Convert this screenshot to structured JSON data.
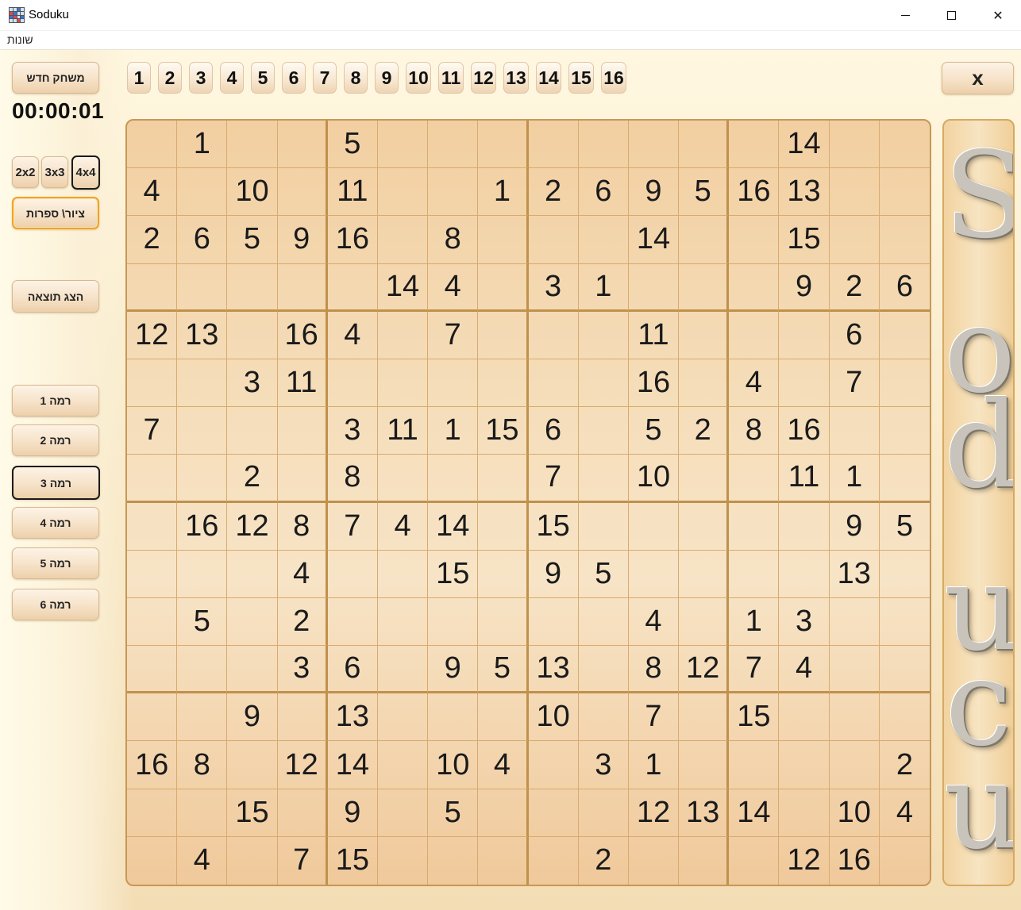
{
  "window": {
    "title": "Soduku"
  },
  "menu": {
    "misc": "שונות"
  },
  "controls": {
    "new_game": "משחק חדש",
    "timer": "00:00:01",
    "size_2x2": "2x2",
    "size_3x3": "3x3",
    "size_4x4": "4x4",
    "draw_digits": "ציור\\ ספרות",
    "show_result": "הצג תוצאה",
    "close": "x"
  },
  "levels": [
    "רמה 1",
    "רמה 2",
    "רמה 3",
    "רמה 4",
    "רמה 5",
    "רמה 6"
  ],
  "selected_level": 3,
  "selected_size": "4x4",
  "number_buttons": [
    "1",
    "2",
    "3",
    "4",
    "5",
    "6",
    "7",
    "8",
    "9",
    "10",
    "11",
    "12",
    "13",
    "14",
    "15",
    "16"
  ],
  "logo": {
    "letters": [
      "S",
      "o",
      "d",
      "u",
      "c",
      "u"
    ]
  },
  "board": [
    [
      "",
      "1",
      "",
      "",
      "5",
      "",
      "",
      "",
      "",
      "",
      "",
      "",
      "",
      "14",
      "",
      ""
    ],
    [
      "4",
      "",
      "10",
      "",
      "11",
      "",
      "",
      "1",
      "2",
      "6",
      "9",
      "5",
      "16",
      "13",
      "",
      ""
    ],
    [
      "2",
      "6",
      "5",
      "9",
      "16",
      "",
      "8",
      "",
      "",
      "",
      "14",
      "",
      "",
      "15",
      "",
      ""
    ],
    [
      "",
      "",
      "",
      "",
      "",
      "14",
      "4",
      "",
      "3",
      "1",
      "",
      "",
      "",
      "9",
      "2",
      "6"
    ],
    [
      "12",
      "13",
      "",
      "16",
      "4",
      "",
      "7",
      "",
      "",
      "",
      "11",
      "",
      "",
      "",
      "6",
      ""
    ],
    [
      "",
      "",
      "3",
      "11",
      "",
      "",
      "",
      "",
      "",
      "",
      "16",
      "",
      "4",
      "",
      "7",
      ""
    ],
    [
      "7",
      "",
      "",
      "",
      "3",
      "11",
      "1",
      "15",
      "6",
      "",
      "5",
      "2",
      "8",
      "16",
      "",
      ""
    ],
    [
      "",
      "",
      "2",
      "",
      "8",
      "",
      "",
      "",
      "7",
      "",
      "10",
      "",
      "",
      "11",
      "1",
      ""
    ],
    [
      "",
      "16",
      "12",
      "8",
      "7",
      "4",
      "14",
      "",
      "15",
      "",
      "",
      "",
      "",
      "",
      "9",
      "5"
    ],
    [
      "",
      "",
      "",
      "4",
      "",
      "",
      "15",
      "",
      "9",
      "5",
      "",
      "",
      "",
      "",
      "13",
      ""
    ],
    [
      "",
      "5",
      "",
      "2",
      "",
      "",
      "",
      "",
      "",
      "",
      "4",
      "",
      "1",
      "3",
      "",
      ""
    ],
    [
      "",
      "",
      "",
      "3",
      "6",
      "",
      "9",
      "5",
      "13",
      "",
      "8",
      "12",
      "7",
      "4",
      "",
      ""
    ],
    [
      "",
      "",
      "9",
      "",
      "13",
      "",
      "",
      "",
      "10",
      "",
      "7",
      "",
      "15",
      "",
      "",
      ""
    ],
    [
      "16",
      "8",
      "",
      "12",
      "14",
      "",
      "10",
      "4",
      "",
      "3",
      "1",
      "",
      "",
      "",
      "",
      "2"
    ],
    [
      "",
      "",
      "15",
      "",
      "9",
      "",
      "5",
      "",
      "",
      "",
      "12",
      "13",
      "14",
      "",
      "10",
      "4"
    ],
    [
      "",
      "4",
      "",
      "7",
      "15",
      "",
      "",
      "",
      "",
      "2",
      "",
      "",
      "",
      "12",
      "16",
      ""
    ]
  ]
}
